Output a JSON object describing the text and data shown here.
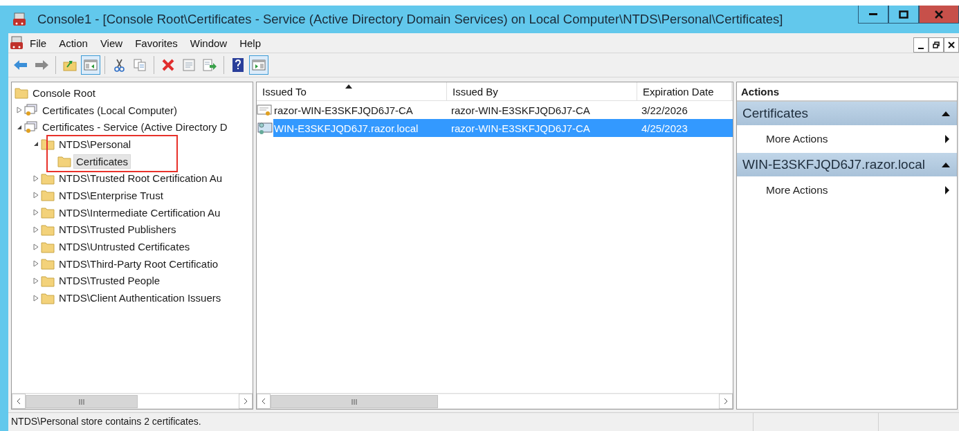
{
  "window": {
    "title": "Console1 - [Console Root\\Certificates - Service (Active Directory Domain Services) on Local Computer\\NTDS\\Personal\\Certificates]"
  },
  "menu": [
    "File",
    "Action",
    "View",
    "Favorites",
    "Window",
    "Help"
  ],
  "toolbar": [
    {
      "kind": "back",
      "pressed": false
    },
    {
      "kind": "forward",
      "pressed": false
    },
    {
      "kind": "sep"
    },
    {
      "kind": "up",
      "pressed": false
    },
    {
      "kind": "tree",
      "pressed": true
    },
    {
      "kind": "sep"
    },
    {
      "kind": "cut",
      "pressed": false
    },
    {
      "kind": "copy",
      "pressed": false
    },
    {
      "kind": "sep"
    },
    {
      "kind": "delete",
      "pressed": false
    },
    {
      "kind": "properties",
      "pressed": false
    },
    {
      "kind": "export",
      "pressed": false
    },
    {
      "kind": "sep"
    },
    {
      "kind": "help",
      "pressed": false
    },
    {
      "kind": "actionpane",
      "pressed": true
    }
  ],
  "tree": [
    {
      "label": "Console Root",
      "kind": "folder",
      "selected": false,
      "children": [
        {
          "label": "Certificates (Local Computer)",
          "kind": "store",
          "expanded": false,
          "selected": false
        },
        {
          "label": "Certificates - Service (Active Directory D",
          "kind": "store",
          "expanded": true,
          "selected": false,
          "children": [
            {
              "label": "NTDS\\Personal",
              "kind": "folder",
              "expanded": true,
              "selected": false,
              "highlighted": true,
              "children": [
                {
                  "label": "Certificates",
                  "kind": "folder",
                  "selected": true
                }
              ]
            },
            {
              "label": "NTDS\\Trusted Root Certification Au",
              "kind": "folder",
              "expanded": false,
              "selected": false
            },
            {
              "label": "NTDS\\Enterprise Trust",
              "kind": "folder",
              "expanded": false,
              "selected": false
            },
            {
              "label": "NTDS\\Intermediate Certification Au",
              "kind": "folder",
              "expanded": false,
              "selected": false
            },
            {
              "label": "NTDS\\Trusted Publishers",
              "kind": "folder",
              "expanded": false,
              "selected": false
            },
            {
              "label": "NTDS\\Untrusted Certificates",
              "kind": "folder",
              "expanded": false,
              "selected": false
            },
            {
              "label": "NTDS\\Third-Party Root Certificatio",
              "kind": "folder",
              "expanded": false,
              "selected": false
            },
            {
              "label": "NTDS\\Trusted People",
              "kind": "folder",
              "expanded": false,
              "selected": false
            },
            {
              "label": "NTDS\\Client Authentication Issuers",
              "kind": "folder",
              "expanded": false,
              "selected": false
            }
          ]
        }
      ]
    }
  ],
  "table": {
    "columns": [
      {
        "label": "Issued To",
        "sorted": true
      },
      {
        "label": "Issued By",
        "sorted": false
      },
      {
        "label": "Expiration Date",
        "sorted": false
      }
    ],
    "rows": [
      {
        "kind": "ca",
        "selected": false,
        "cells": [
          "razor-WIN-E3SKFJQD6J7-CA",
          "razor-WIN-E3SKFJQD6J7-CA",
          "3/22/2026"
        ]
      },
      {
        "kind": "cert",
        "selected": true,
        "cells": [
          "WIN-E3SKFJQD6J7.razor.local",
          "razor-WIN-E3SKFJQD6J7-CA",
          "4/25/2023"
        ]
      }
    ]
  },
  "actions": {
    "title": "Actions",
    "groups": [
      {
        "title": "Certificates",
        "expanded": true,
        "items": [
          "More Actions"
        ]
      },
      {
        "title": "WIN-E3SKFJQD6J7.razor.local",
        "expanded": true,
        "items": [
          "More Actions"
        ]
      }
    ]
  },
  "status_bar": "NTDS\\Personal store contains 2 certificates."
}
